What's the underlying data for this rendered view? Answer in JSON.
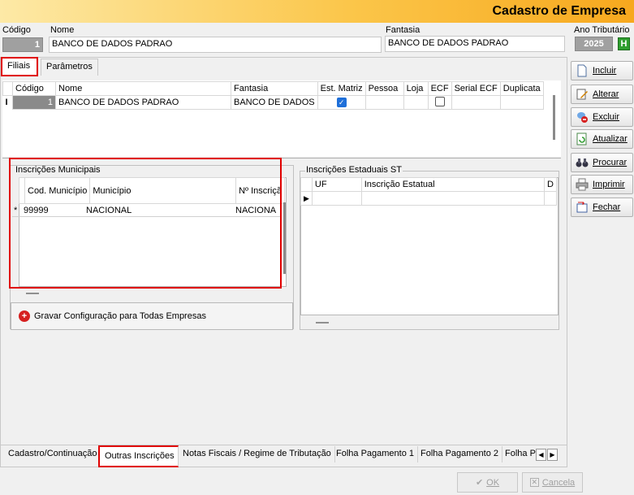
{
  "window": {
    "title": "Cadastro de Empresa"
  },
  "header": {
    "codigo_label": "Código",
    "codigo_value": "1",
    "nome_label": "Nome",
    "nome_value": "BANCO DE DADOS PADRAO",
    "fantasia_label": "Fantasia",
    "fantasia_value": "BANCO DE DADOS PADRAO",
    "ano_label": "Ano Tributário",
    "ano_value": "2025",
    "ano_button": "H"
  },
  "top_tabs": [
    {
      "label": "Filiais"
    },
    {
      "label": "Parâmetros"
    }
  ],
  "filiais_grid": {
    "columns": [
      "Código",
      "Nome",
      "Fantasia",
      "Est. Matriz",
      "Pessoa",
      "Loja",
      "ECF",
      "Serial ECF",
      "Duplicata"
    ],
    "row": {
      "indicator": "I",
      "codigo": "1",
      "nome": "BANCO DE DADOS PADRAO",
      "fantasia": "BANCO DE DADOS",
      "est_matriz": true,
      "ecf": false
    }
  },
  "municipais": {
    "title": "Inscrições Municipais",
    "columns": [
      "Cod. Município",
      "Município",
      "Nº Inscriçã"
    ],
    "row": {
      "indicator": "*",
      "cod": "99999",
      "municipio": "NACIONAL",
      "inscricao": "NACIONA"
    }
  },
  "gravar_button": "Gravar Configuração para Todas Empresas",
  "estaduais": {
    "title": "Inscrições Estaduais ST",
    "columns": [
      "UF",
      "Inscrição Estatual",
      "D"
    ]
  },
  "side_buttons": [
    {
      "label": "Incluir",
      "icon": "document-icon"
    },
    {
      "label": "Alterar",
      "icon": "edit-icon"
    },
    {
      "label": "Excluir",
      "icon": "delete-icon"
    },
    {
      "label": "Atualizar",
      "icon": "refresh-icon"
    },
    {
      "label": "Procurar",
      "icon": "binoculars-icon"
    },
    {
      "label": "Imprimir",
      "icon": "printer-icon"
    },
    {
      "label": "Fechar",
      "icon": "exit-icon"
    }
  ],
  "bottom_tabs": [
    {
      "label": "Cadastro/Continuação"
    },
    {
      "label": "Outras Inscrições"
    },
    {
      "label": "Notas Fiscais / Regime de Tributação"
    },
    {
      "label": "Folha Pagamento 1"
    },
    {
      "label": "Folha Pagamento 2"
    },
    {
      "label": "Folha P"
    }
  ],
  "footer": {
    "ok_label": "OK",
    "cancel_label": "Cancela"
  },
  "colors": {
    "title_gradient_start": "#fde9a6",
    "title_gradient_end": "#f7a81e",
    "highlight_red": "#e00000",
    "check_blue": "#1e6fd9"
  }
}
